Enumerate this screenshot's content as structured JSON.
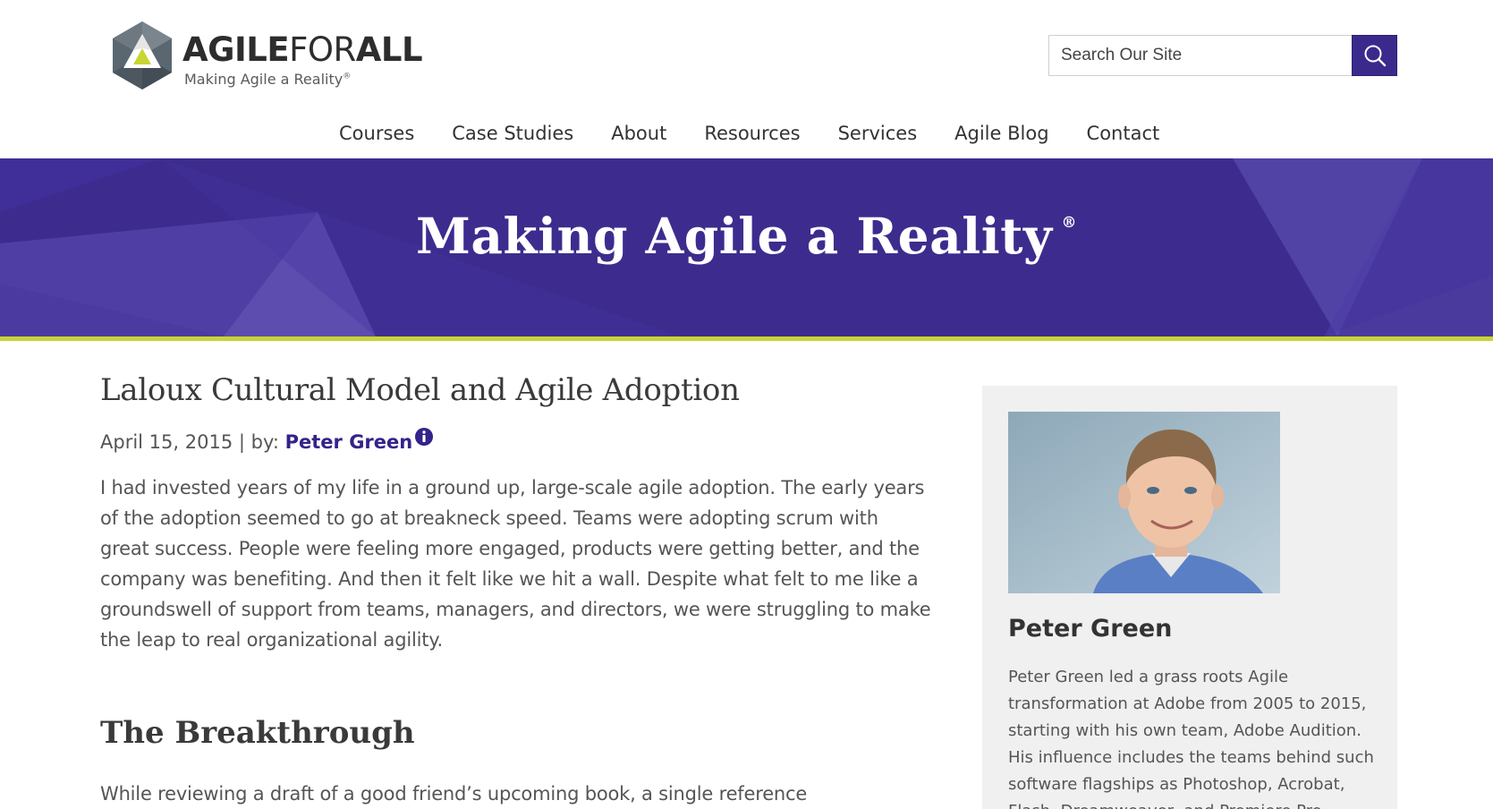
{
  "header": {
    "logo_wordmark_bold_1": "AGILE",
    "logo_wordmark_light": "FOR",
    "logo_wordmark_bold_2": "ALL",
    "logo_tagline": "Making Agile a Reality",
    "logo_tagline_mark": "®",
    "search": {
      "placeholder": "Search Our Site",
      "button_icon": "search-icon"
    }
  },
  "nav": {
    "items": [
      {
        "label": "Courses"
      },
      {
        "label": "Case Studies"
      },
      {
        "label": "About"
      },
      {
        "label": "Resources"
      },
      {
        "label": "Services"
      },
      {
        "label": "Agile Blog"
      },
      {
        "label": "Contact"
      }
    ]
  },
  "hero": {
    "title": "Making Agile a Reality",
    "title_mark": "®"
  },
  "post": {
    "title": "Laloux Cultural Model and Agile Adoption",
    "date_prefix": "April 15, 2015 | by: ",
    "author": "Peter Green",
    "author_info_icon": "info-icon",
    "body": "I had invested years of my life in a ground up, large-scale agile adoption. The early years of the adoption seemed to go at breakneck speed. Teams were adopting scrum with great success. People were feeling more engaged, products were getting better, and the company was benefiting. And then it felt like we hit a wall. Despite what felt to me like a groundswell of support from teams, managers, and directors, we were struggling to make the leap to real organizational agility.",
    "section_heading": "The Breakthrough",
    "section_body": "While reviewing a draft of a good friend’s upcoming book, a single reference"
  },
  "sidebar": {
    "author_name": "Peter Green",
    "author_bio": "Peter Green led a grass roots Agile transformation at Adobe from 2005 to 2015, starting with his own team, Adobe Audition. His influence includes the teams behind such software flagships as Photoshop, Acrobat, Flash, Dreamweaver, and Premiere Pro."
  },
  "colors": {
    "brand_purple": "#3d2c8e",
    "accent_lime": "#c8d533",
    "link_purple": "#33238a"
  }
}
